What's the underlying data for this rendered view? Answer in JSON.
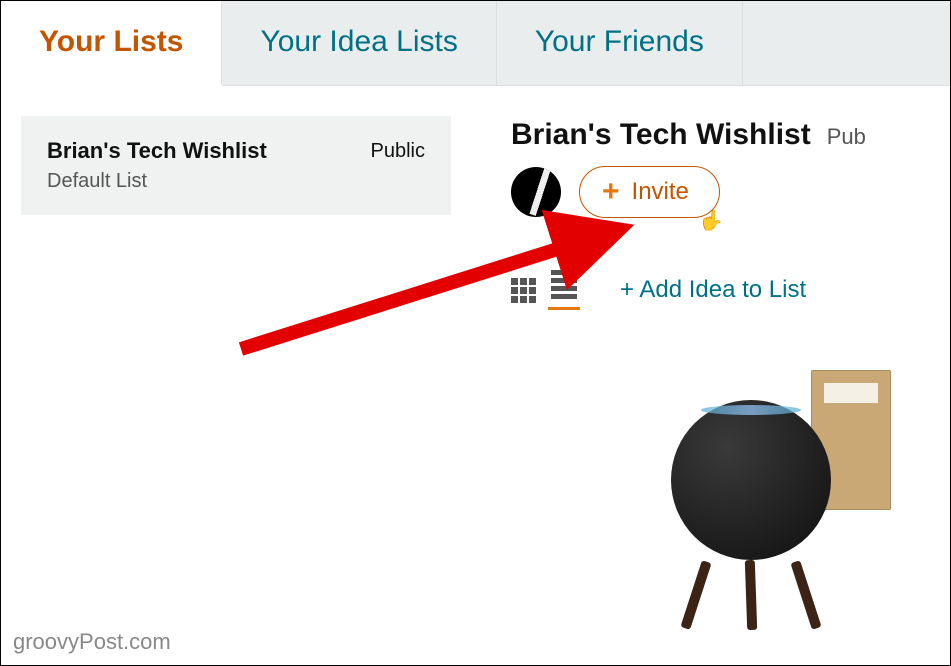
{
  "tabs": {
    "your_lists": "Your Lists",
    "your_idea_lists": "Your Idea Lists",
    "your_friends": "Your Friends"
  },
  "sidebar": {
    "list_name": "Brian's Tech Wishlist",
    "visibility": "Public",
    "sublabel": "Default List"
  },
  "main": {
    "title": "Brian's Tech Wishlist",
    "visibility": "Pub",
    "invite_label": "Invite",
    "add_idea_label": "+ Add Idea to List"
  },
  "watermark": "groovyPost.com"
}
